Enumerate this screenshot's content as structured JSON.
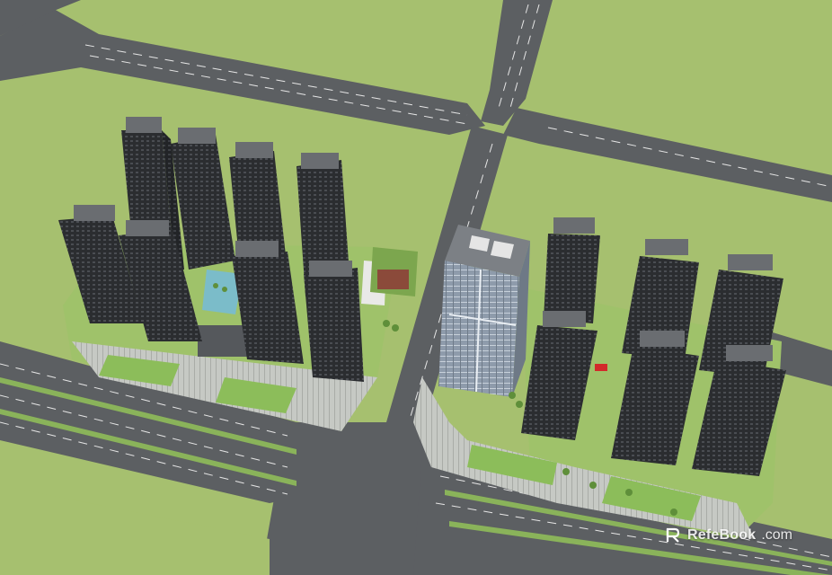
{
  "image": {
    "kind": "3D aerial rendering of a residential and office development at a road intersection"
  },
  "colors": {
    "grass": "#a6c06f",
    "road": "#5c5f62",
    "lane_marking": "#e8e8e8",
    "median_green": "#8ab35a",
    "plaza": "#c9ccc7",
    "tower_dark": "#2c2e31",
    "tower_top": "#7b7e82",
    "office_glass": "#9aa6b4",
    "red_accent": "#d22a2a"
  },
  "watermark": {
    "brand": "RefeBook",
    "domain": ".com"
  }
}
